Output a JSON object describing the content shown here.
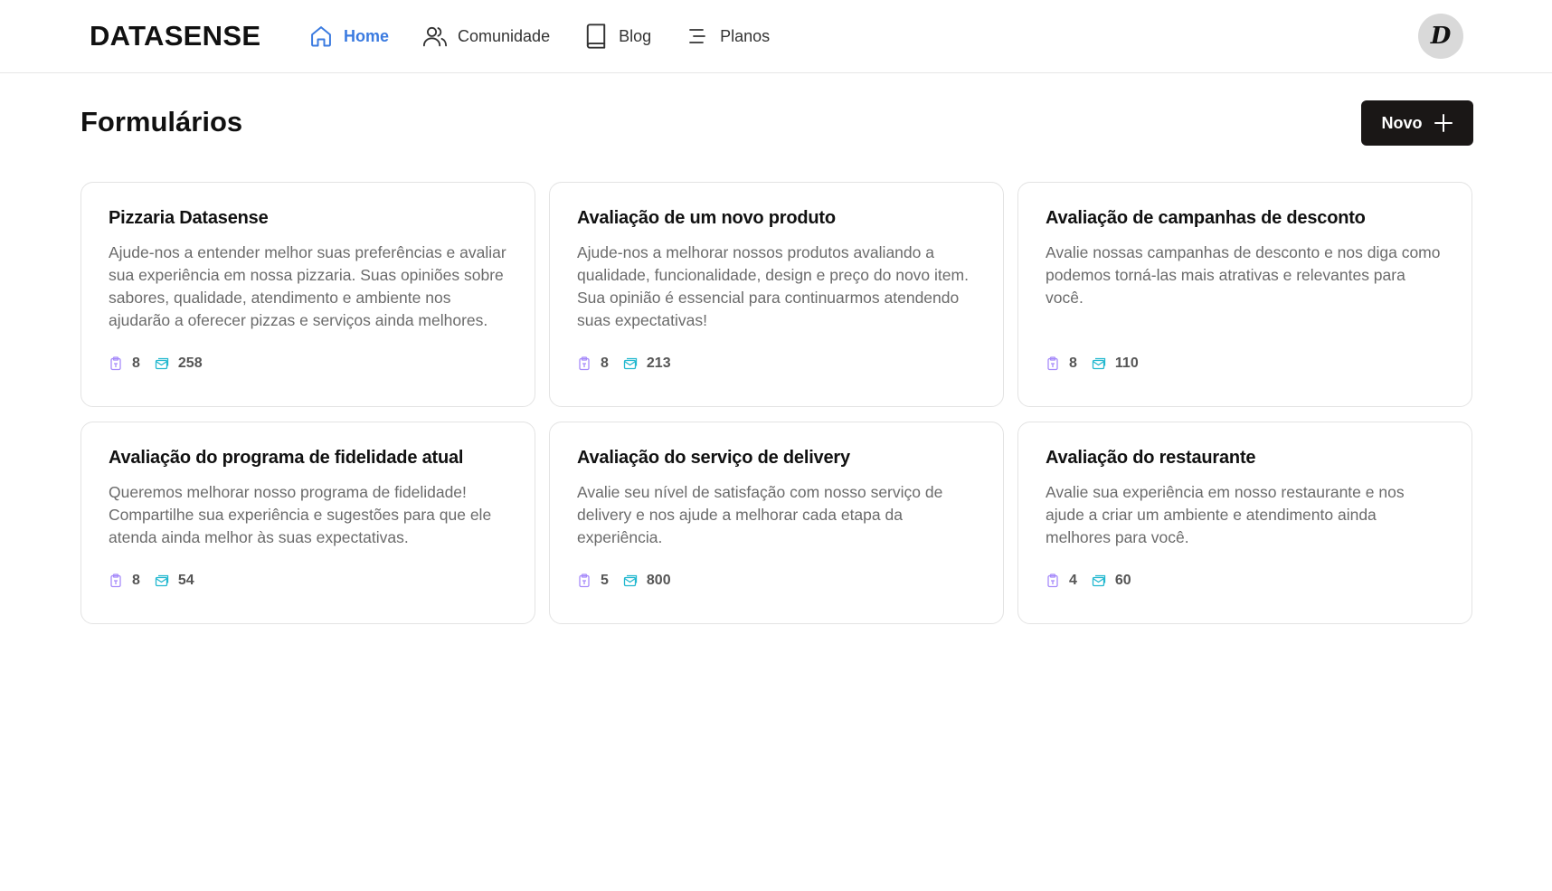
{
  "header": {
    "brand": "DATASENSE",
    "nav": [
      {
        "label": "Home",
        "icon": "home-icon",
        "active": true
      },
      {
        "label": "Comunidade",
        "icon": "users-icon",
        "active": false
      },
      {
        "label": "Blog",
        "icon": "book-icon",
        "active": false
      },
      {
        "label": "Planos",
        "icon": "list-icon",
        "active": false
      }
    ],
    "avatar_letter": "D"
  },
  "main": {
    "title": "Formulários",
    "new_button_label": "Novo",
    "cards": [
      {
        "title": "Pizzaria Datasense",
        "description": "Ajude-nos a entender melhor suas preferências e avaliar sua experiência em nossa pizzaria. Suas opiniões sobre sabores, qualidade, atendimento e ambiente nos ajudarão a oferecer pizzas e serviços ainda melhores.",
        "questions": "8",
        "responses": "258"
      },
      {
        "title": "Avaliação de um novo produto",
        "description": "Ajude-nos a melhorar nossos produtos avaliando a qualidade, funcionalidade, design e preço do novo item. Sua opinião é essencial para continuarmos atendendo suas expectativas!",
        "questions": "8",
        "responses": "213"
      },
      {
        "title": "Avaliação de campanhas de desconto",
        "description": "Avalie nossas campanhas de desconto e nos diga como podemos torná-las mais atrativas e relevantes para você.",
        "questions": "8",
        "responses": "110"
      },
      {
        "title": "Avaliação do programa de fidelidade atual",
        "description": "Queremos melhorar nosso programa de fidelidade! Compartilhe sua experiência e sugestões para que ele atenda ainda melhor às suas expectativas.",
        "questions": "8",
        "responses": "54"
      },
      {
        "title": "Avaliação do serviço de delivery",
        "description": "Avalie seu nível de satisfação com nosso serviço de delivery e nos ajude a melhorar cada etapa da experiência.",
        "questions": "5",
        "responses": "800"
      },
      {
        "title": "Avaliação do restaurante",
        "description": "Avalie sua experiência em nosso restaurante e nos ajude a criar um ambiente e atendimento ainda melhores para você.",
        "questions": "4",
        "responses": "60"
      }
    ]
  },
  "colors": {
    "accent": "#3b7be0",
    "button_bg": "#1a1716",
    "question_icon": "#a78bfa",
    "response_icon": "#22b8cf"
  }
}
